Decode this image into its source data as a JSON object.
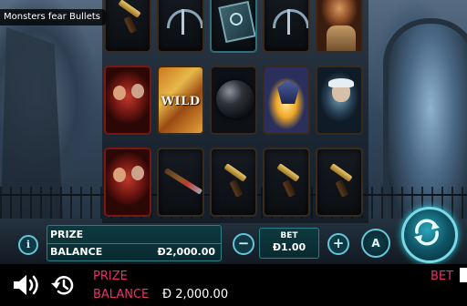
{
  "game": {
    "title": "Monsters fear Bullets"
  },
  "reels": [
    [
      "pistol",
      "monster-duo",
      "monster-duo"
    ],
    [
      "crossbow",
      "wild",
      "rifle"
    ],
    [
      "spell-book",
      "bomb",
      "pistol"
    ],
    [
      "crossbow",
      "wolf",
      "pistol"
    ],
    [
      "huntress",
      "hunter",
      "pistol"
    ]
  ],
  "wild_label": "WILD",
  "control": {
    "info_label": "i",
    "prize_label": "PRIZE",
    "balance_label": "BALANCE",
    "balance_value": "Ɖ2,000.00",
    "minus_label": "−",
    "bet_label": "BET",
    "bet_value": "Ɖ1.00",
    "plus_label": "+",
    "auto_label": "A"
  },
  "status": {
    "prize_label": "PRIZE",
    "balance_label": "BALANCE",
    "balance_value": "Ɖ 2,000.00",
    "bet_label": "BET"
  },
  "colors": {
    "accent": "#64c6d8",
    "status_text": "#e8316b",
    "panel_bg": "#0d3a3f"
  }
}
